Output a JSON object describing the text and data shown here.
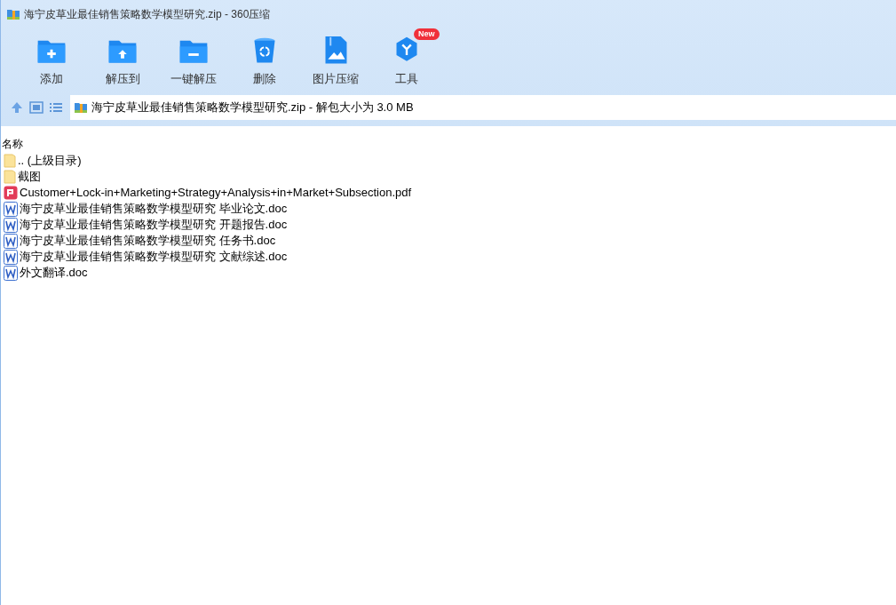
{
  "window": {
    "title": "海宁皮草业最佳销售策略数学模型研究.zip - 360压缩"
  },
  "toolbar": [
    {
      "kind": "add",
      "label": "添加"
    },
    {
      "kind": "extract",
      "label": "解压到"
    },
    {
      "kind": "oneclick",
      "label": "一键解压"
    },
    {
      "kind": "delete",
      "label": "删除"
    },
    {
      "kind": "image",
      "label": "图片压缩"
    },
    {
      "kind": "tools",
      "label": "工具",
      "badge": "New"
    }
  ],
  "address_bar": {
    "path": "海宁皮草业最佳销售策略数学模型研究.zip - 解包大小为 3.0 MB"
  },
  "file_list": {
    "columns": [
      "名称"
    ],
    "rows": [
      {
        "kind": "folder",
        "name": ".. (上级目录)"
      },
      {
        "kind": "folder",
        "name": "截图"
      },
      {
        "kind": "pdf",
        "name": "Customer+Lock-in+Marketing+Strategy+Analysis+in+Market+Subsection.pdf"
      },
      {
        "kind": "doc",
        "name": "海宁皮草业最佳销售策略数学模型研究 毕业论文.doc"
      },
      {
        "kind": "doc",
        "name": "海宁皮草业最佳销售策略数学模型研究 开题报告.doc"
      },
      {
        "kind": "doc",
        "name": "海宁皮草业最佳销售策略数学模型研究 任务书.doc"
      },
      {
        "kind": "doc",
        "name": "海宁皮草业最佳销售策略数学模型研究 文献综述.doc"
      },
      {
        "kind": "doc",
        "name": "外文翻译.doc"
      }
    ]
  }
}
